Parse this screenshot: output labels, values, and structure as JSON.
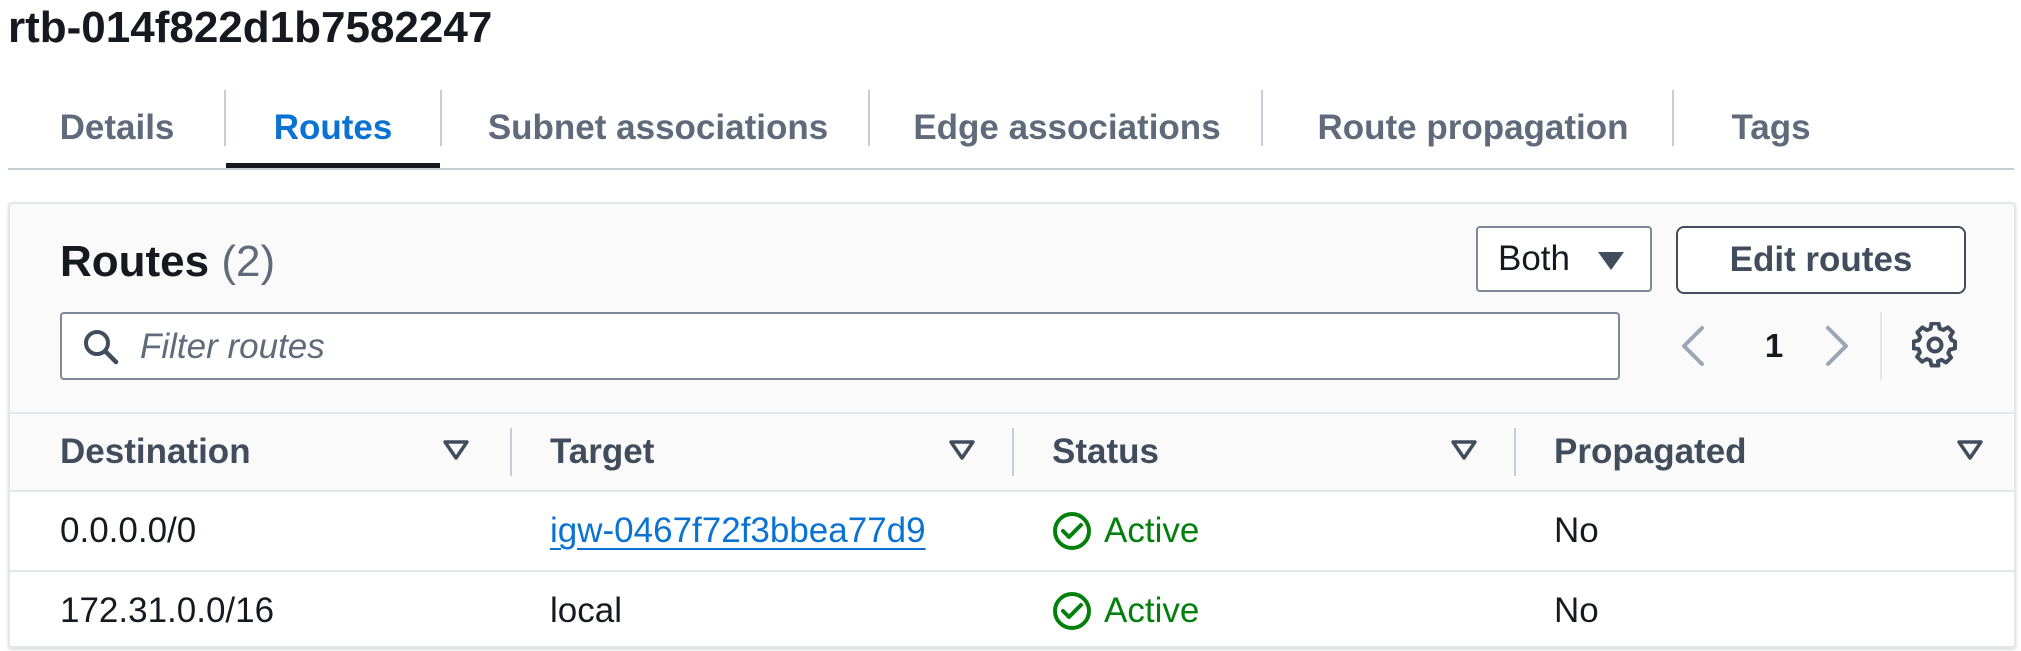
{
  "page": {
    "title": "rtb-014f822d1b7582247"
  },
  "tabs": [
    {
      "label": "Details",
      "active": false
    },
    {
      "label": "Routes",
      "active": true
    },
    {
      "label": "Subnet associations",
      "active": false
    },
    {
      "label": "Edge associations",
      "active": false
    },
    {
      "label": "Route propagation",
      "active": false
    },
    {
      "label": "Tags",
      "active": false
    }
  ],
  "routes_panel": {
    "heading": "Routes",
    "count": "(2)",
    "filter_select": "Both",
    "edit_button": "Edit routes",
    "search_placeholder": "Filter routes",
    "current_page": "1",
    "columns": [
      "Destination",
      "Target",
      "Status",
      "Propagated"
    ],
    "rows": [
      {
        "destination": "0.0.0.0/0",
        "target": "igw-0467f72f3bbea77d9",
        "target_is_link": true,
        "status": "Active",
        "propagated": "No"
      },
      {
        "destination": "172.31.0.0/16",
        "target": "local",
        "target_is_link": false,
        "status": "Active",
        "propagated": "No"
      }
    ]
  },
  "colors": {
    "accent": "#0972d3",
    "status_success": "#037f0c",
    "text_primary": "#16191f",
    "text_secondary": "#5f6b7a"
  },
  "icons": [
    "search-icon",
    "caret-down-icon",
    "chevron-left-icon",
    "chevron-right-icon",
    "gear-icon",
    "sort-icon",
    "check-circle-icon"
  ]
}
